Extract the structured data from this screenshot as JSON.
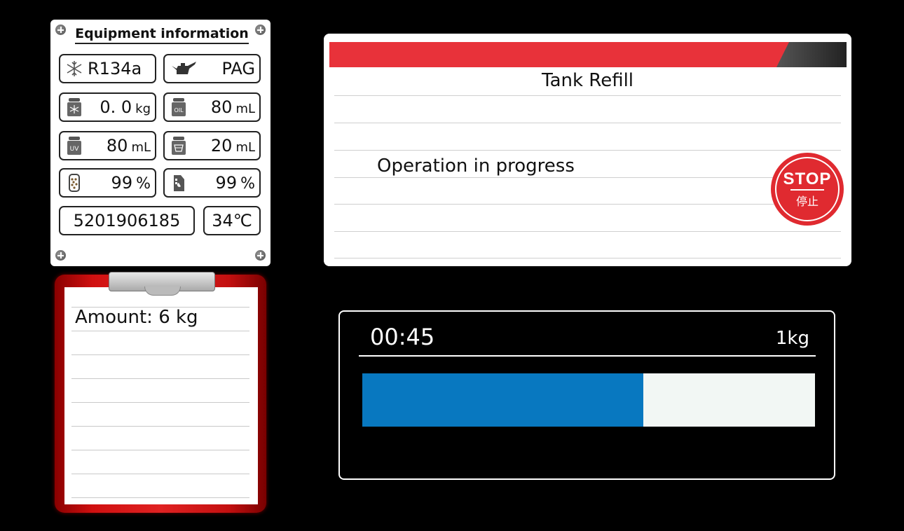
{
  "equipment": {
    "title": "Equipment information",
    "refrigerant": {
      "icon": "snowflake-icon",
      "value": "R134a"
    },
    "oil_type": {
      "icon": "oil-can-icon",
      "value": "PAG"
    },
    "refrigerant_amount": {
      "icon": "refrigerant-bottle-icon",
      "value": "0. 0",
      "unit": "kg"
    },
    "oil_amount": {
      "icon": "oil-bottle-icon",
      "value": "80",
      "unit": "mL"
    },
    "uv_amount": {
      "icon": "uv-bottle-icon",
      "value": "80",
      "unit": "mL"
    },
    "waste_oil_amount": {
      "icon": "waste-oil-bottle-icon",
      "value": "20",
      "unit": "mL"
    },
    "filter_level": {
      "icon": "filter-cartridge-icon",
      "value": "99",
      "unit": "%"
    },
    "oil_level": {
      "icon": "oil-jug-icon",
      "value": "99",
      "unit": "%"
    },
    "serial_number": "5201906185",
    "temperature": "34℃"
  },
  "clipboard": {
    "amount_text": "Amount: 6 kg"
  },
  "tank": {
    "title": "Tank Refill",
    "status": "Operation in progress",
    "stop_label": "STOP",
    "stop_label_cn": "停止"
  },
  "progress": {
    "time": "00:45",
    "mass": "1kg",
    "fraction": 0.62
  },
  "colors": {
    "header_red": "#e8323a",
    "progress_blue": "#0878c0",
    "stop_red": "#e02a30",
    "clipboard_red": "#d01010"
  }
}
